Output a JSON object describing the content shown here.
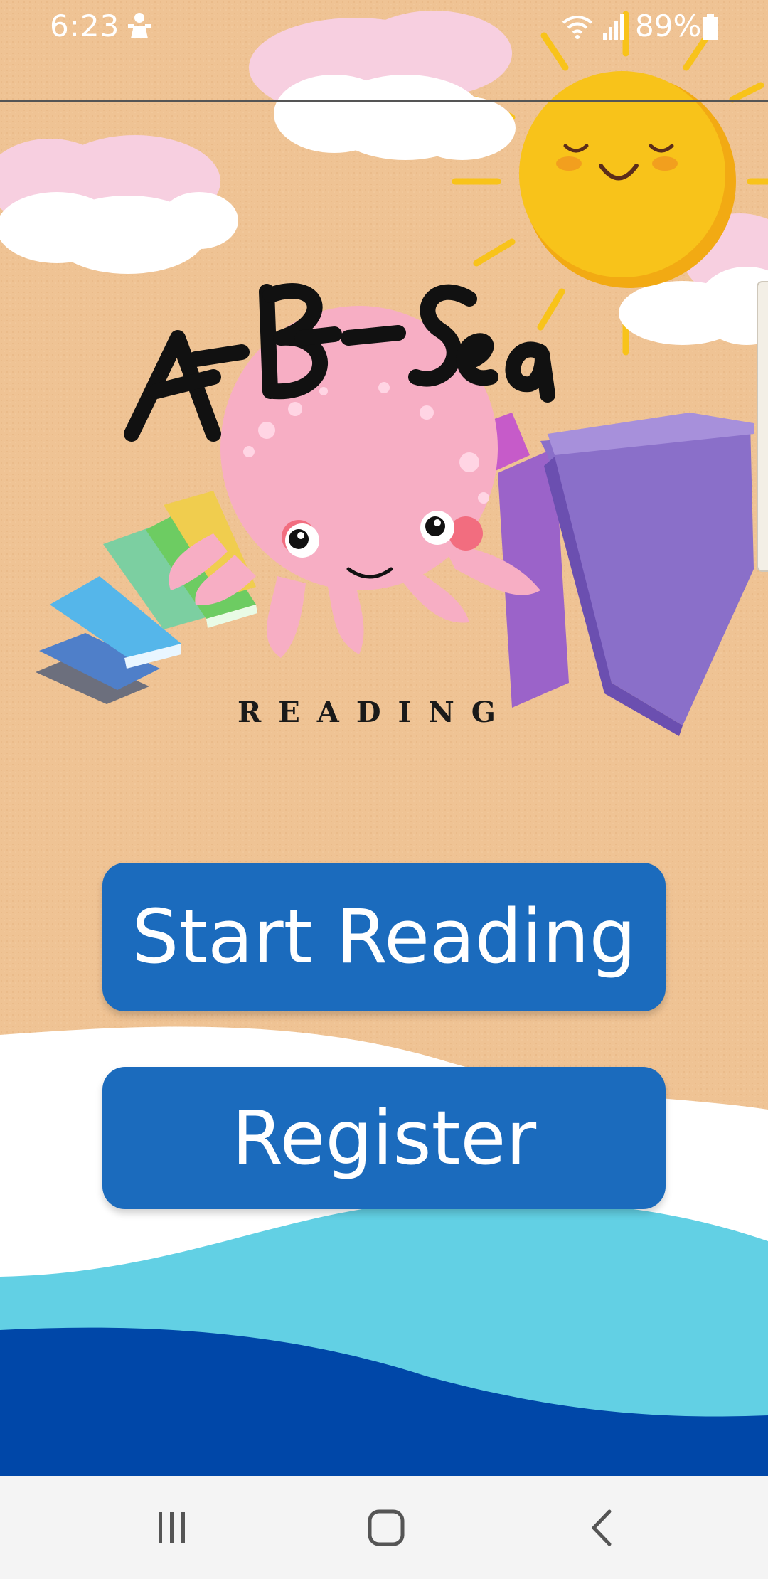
{
  "status_bar": {
    "time": "6:23",
    "battery_percent": "89%",
    "icons": [
      "person-icon",
      "wifi-icon",
      "signal-icon",
      "battery-icon"
    ]
  },
  "logo": {
    "title": "A-B-Sea",
    "subtitle": "READING",
    "mascot": "octopus"
  },
  "buttons": {
    "start_reading": "Start Reading",
    "register": "Register"
  },
  "nav_bar": {
    "icons": [
      "recent-apps-icon",
      "home-icon",
      "back-icon"
    ]
  },
  "colors": {
    "sand": "#efc394",
    "button_blue": "#1b6bbd",
    "sea_light": "#62d0e4",
    "sea_dark": "#0047a8",
    "sun": "#f8c31a",
    "octopus": "#f7aec4"
  }
}
